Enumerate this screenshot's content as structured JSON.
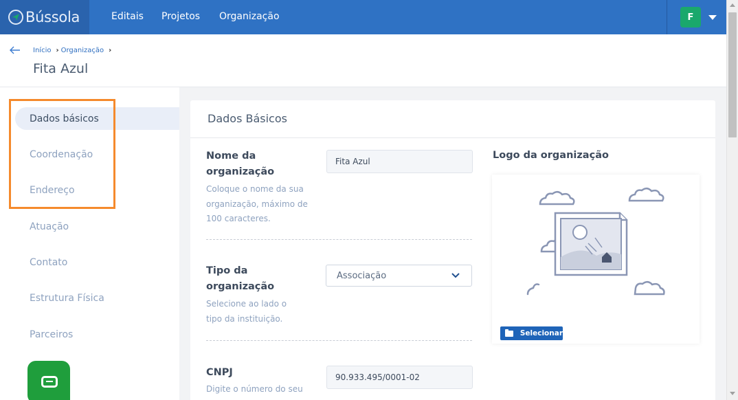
{
  "app": {
    "logo_text": "Bússola",
    "nav": [
      "Editais",
      "Projetos",
      "Organização"
    ],
    "user_initial": "F"
  },
  "header": {
    "breadcrumb": [
      "Início",
      "Organização"
    ],
    "title": "Fita Azul"
  },
  "sidebar": {
    "items": [
      {
        "label": "Dados básicos",
        "active": true
      },
      {
        "label": "Coordenação"
      },
      {
        "label": "Endereço"
      },
      {
        "label": "Atuação"
      },
      {
        "label": "Contato"
      },
      {
        "label": "Estrutura Física"
      },
      {
        "label": "Parceiros"
      }
    ]
  },
  "card": {
    "title": "Dados Básicos",
    "fields": {
      "nome": {
        "label": "Nome da organização",
        "help": "Coloque o nome da sua organização, máximo de 100 caracteres.",
        "value": "Fita Azul"
      },
      "tipo": {
        "label": "Tipo da organização",
        "help": "Selecione ao lado o tipo da instituição.",
        "value": "Associação"
      },
      "cnpj": {
        "label": "CNPJ",
        "help": "Digite o número do seu",
        "value": "90.933.495/0001-02"
      }
    },
    "logo": {
      "label": "Logo da organização",
      "button": "Selecionar"
    }
  },
  "colors": {
    "topbar": "#2f72c4",
    "highlight": "#f58a2c",
    "chat": "#1f9e3c",
    "avatar": "#1aa86c"
  }
}
